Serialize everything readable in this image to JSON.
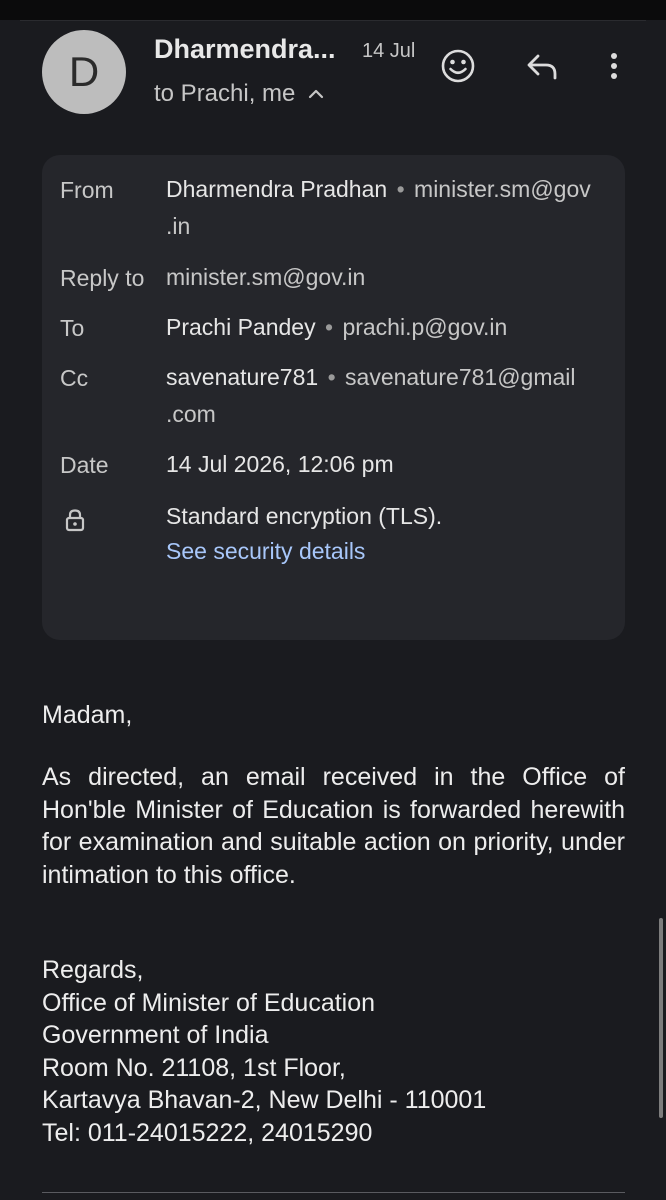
{
  "header": {
    "avatar_letter": "D",
    "sender_name": "Dharmendra...",
    "date": "14 Jul",
    "recipients": "to Prachi, me",
    "icons": [
      "emoji-icon",
      "reply-icon",
      "more-vert-icon",
      "chevron-up-icon"
    ]
  },
  "details": {
    "from": {
      "label": "From",
      "name": "Dharmendra Pradhan",
      "separator": "•",
      "address_line1": "minister.sm@gov",
      "address_line2": ".in"
    },
    "reply_to": {
      "label": "Reply to",
      "address": "minister.sm@gov.in"
    },
    "to": {
      "label": "To",
      "name": "Prachi Pandey",
      "separator": "•",
      "address": "prachi.p@gov.in"
    },
    "cc": {
      "label": "Cc",
      "name": "savenature781",
      "separator": "•",
      "address_line1": "savenature781@gmail",
      "address_line2": ".com"
    },
    "date": {
      "label": "Date",
      "value": "14 Jul 2026, 12:06 pm"
    },
    "security": {
      "icon": "lock-icon",
      "text": "Standard encryption (TLS).",
      "link": "See security details"
    }
  },
  "body": {
    "salutation": "Madam,",
    "paragraph": "As directed, an email received in the Office of Hon'ble Minister of Education is forwarded herewith for examination and suitable action on priority, under intimation to this office.",
    "signature": {
      "closing": "Regards,",
      "line1": "Office of Minister of Education",
      "line2": "Government of India",
      "line3": "Room No. 21108, 1st Floor,",
      "line4": "Kartavya Bhavan-2, New Delhi - 110001",
      "line5": "Tel: 011-24015222, 24015290"
    }
  },
  "colors": {
    "background": "#1a1b1f",
    "card": "#25262b",
    "link": "#a8c7fa",
    "avatar": "#bdbdbd"
  }
}
